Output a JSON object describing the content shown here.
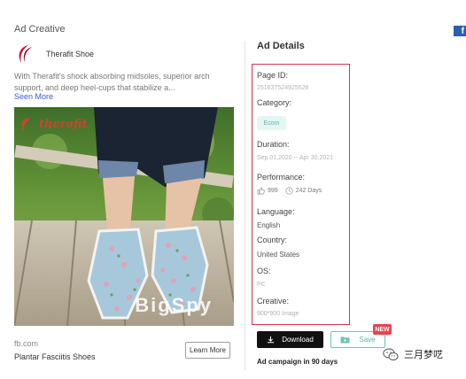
{
  "ad_creative": {
    "section_title": "Ad Creative",
    "brand_name": "Therafit Shoe",
    "ad_text": "With Therafit's shock absorbing midsoles, superior arch support, and deep heel-cups that stabilize a...",
    "see_more": "Seen More",
    "image": {
      "brand_overlay": "therafit",
      "watermark": "BigSpy"
    },
    "domain": "fb.com",
    "headline": "Plantar Fasciitis Shoes",
    "cta": "Learn More"
  },
  "ad_details": {
    "title": "Ad Details",
    "page_id_label": "Page ID:",
    "page_id_value": "251637524925526",
    "category_label": "Category:",
    "category_value": "Ecom",
    "duration_label": "Duration:",
    "duration_value": "Sep 01,2020 -- Apr 30,2021",
    "performance_label": "Performance:",
    "likes": "999",
    "days": "242 Days",
    "language_label": "Language:",
    "language_value": "English",
    "country_label": "Country:",
    "country_value": "United States",
    "os_label": "OS:",
    "os_value": "PC",
    "creative_label": "Creative:",
    "creative_value": "900*900 Image",
    "highlight_color": "#d9374f"
  },
  "actions": {
    "download": "Download",
    "save": "Save",
    "new_badge": "NEW",
    "campaign": "Ad campaign in 90 days"
  },
  "social": {
    "facebook_glyph": "f"
  },
  "watermark_account": {
    "name": "三月梦呓"
  }
}
